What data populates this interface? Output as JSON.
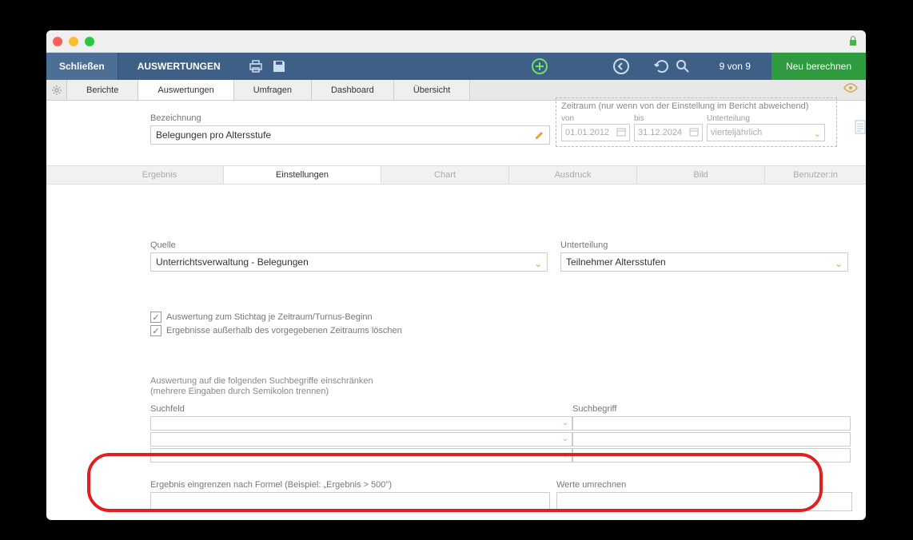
{
  "window": {
    "lock_icon": "lock-icon"
  },
  "topbar": {
    "close": "Schließen",
    "title": "AUSWERTUNGEN",
    "pager": "9 von 9",
    "recalc": "Neu berechnen"
  },
  "tabs": {
    "berichte": "Berichte",
    "auswertungen": "Auswertungen",
    "umfragen": "Umfragen",
    "dashboard": "Dashboard",
    "uebersicht": "Übersicht"
  },
  "form": {
    "bez_label": "Bezeichnung",
    "bez_value": "Belegungen pro Altersstufe",
    "zeitraum_label": "Zeitraum (nur wenn von der Einstellung im Bericht abweichend)",
    "von_label": "von",
    "von_value": "01.01.2012",
    "bis_label": "bis",
    "bis_value": "31.12.2024",
    "unterteilung_label": "Unterteilung",
    "unterteilung_value": "vierteljährlich"
  },
  "subtabs": {
    "ergebnis": "Ergebnis",
    "einstellungen": "Einstellungen",
    "chart": "Chart",
    "ausdruck": "Ausdruck",
    "bild": "Bild",
    "benutzer": "Benutzer:in"
  },
  "settings": {
    "quelle_label": "Quelle",
    "quelle_value": "Unterrichtsverwaltung - Belegungen",
    "unterteilung_label": "Unterteilung",
    "unterteilung_value": "Teilnehmer Altersstufen",
    "check1": "Auswertung zum Stichtag je Zeitraum/Turnus-Beginn",
    "check2": "Ergebnisse außerhalb des vorgegebenen Zeitraums löschen",
    "desc1": "Auswertung auf die folgenden Suchbegriffe einschränken",
    "desc2": "(mehrere Eingaben durch Semikolon trennen)",
    "suchfeld_label": "Suchfeld",
    "suchbegriff_label": "Suchbegriff",
    "formula_label": "Ergebnis eingrenzen nach Formel (Beispiel: „Ergebnis > 500\")",
    "werte_label": "Werte umrechnen"
  }
}
